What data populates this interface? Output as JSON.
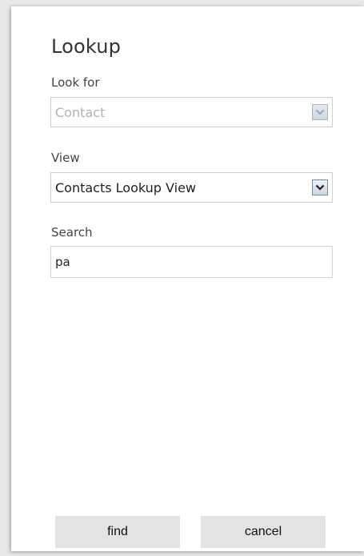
{
  "dialog": {
    "title": "Lookup"
  },
  "look_for": {
    "label": "Look for",
    "value": "Contact",
    "disabled": true,
    "icon": "chevron-down-icon"
  },
  "view": {
    "label": "View",
    "value": "Contacts Lookup View",
    "icon": "chevron-down-icon"
  },
  "search": {
    "label": "Search",
    "value": "pa"
  },
  "buttons": {
    "find_label": "find",
    "cancel_label": "cancel"
  }
}
